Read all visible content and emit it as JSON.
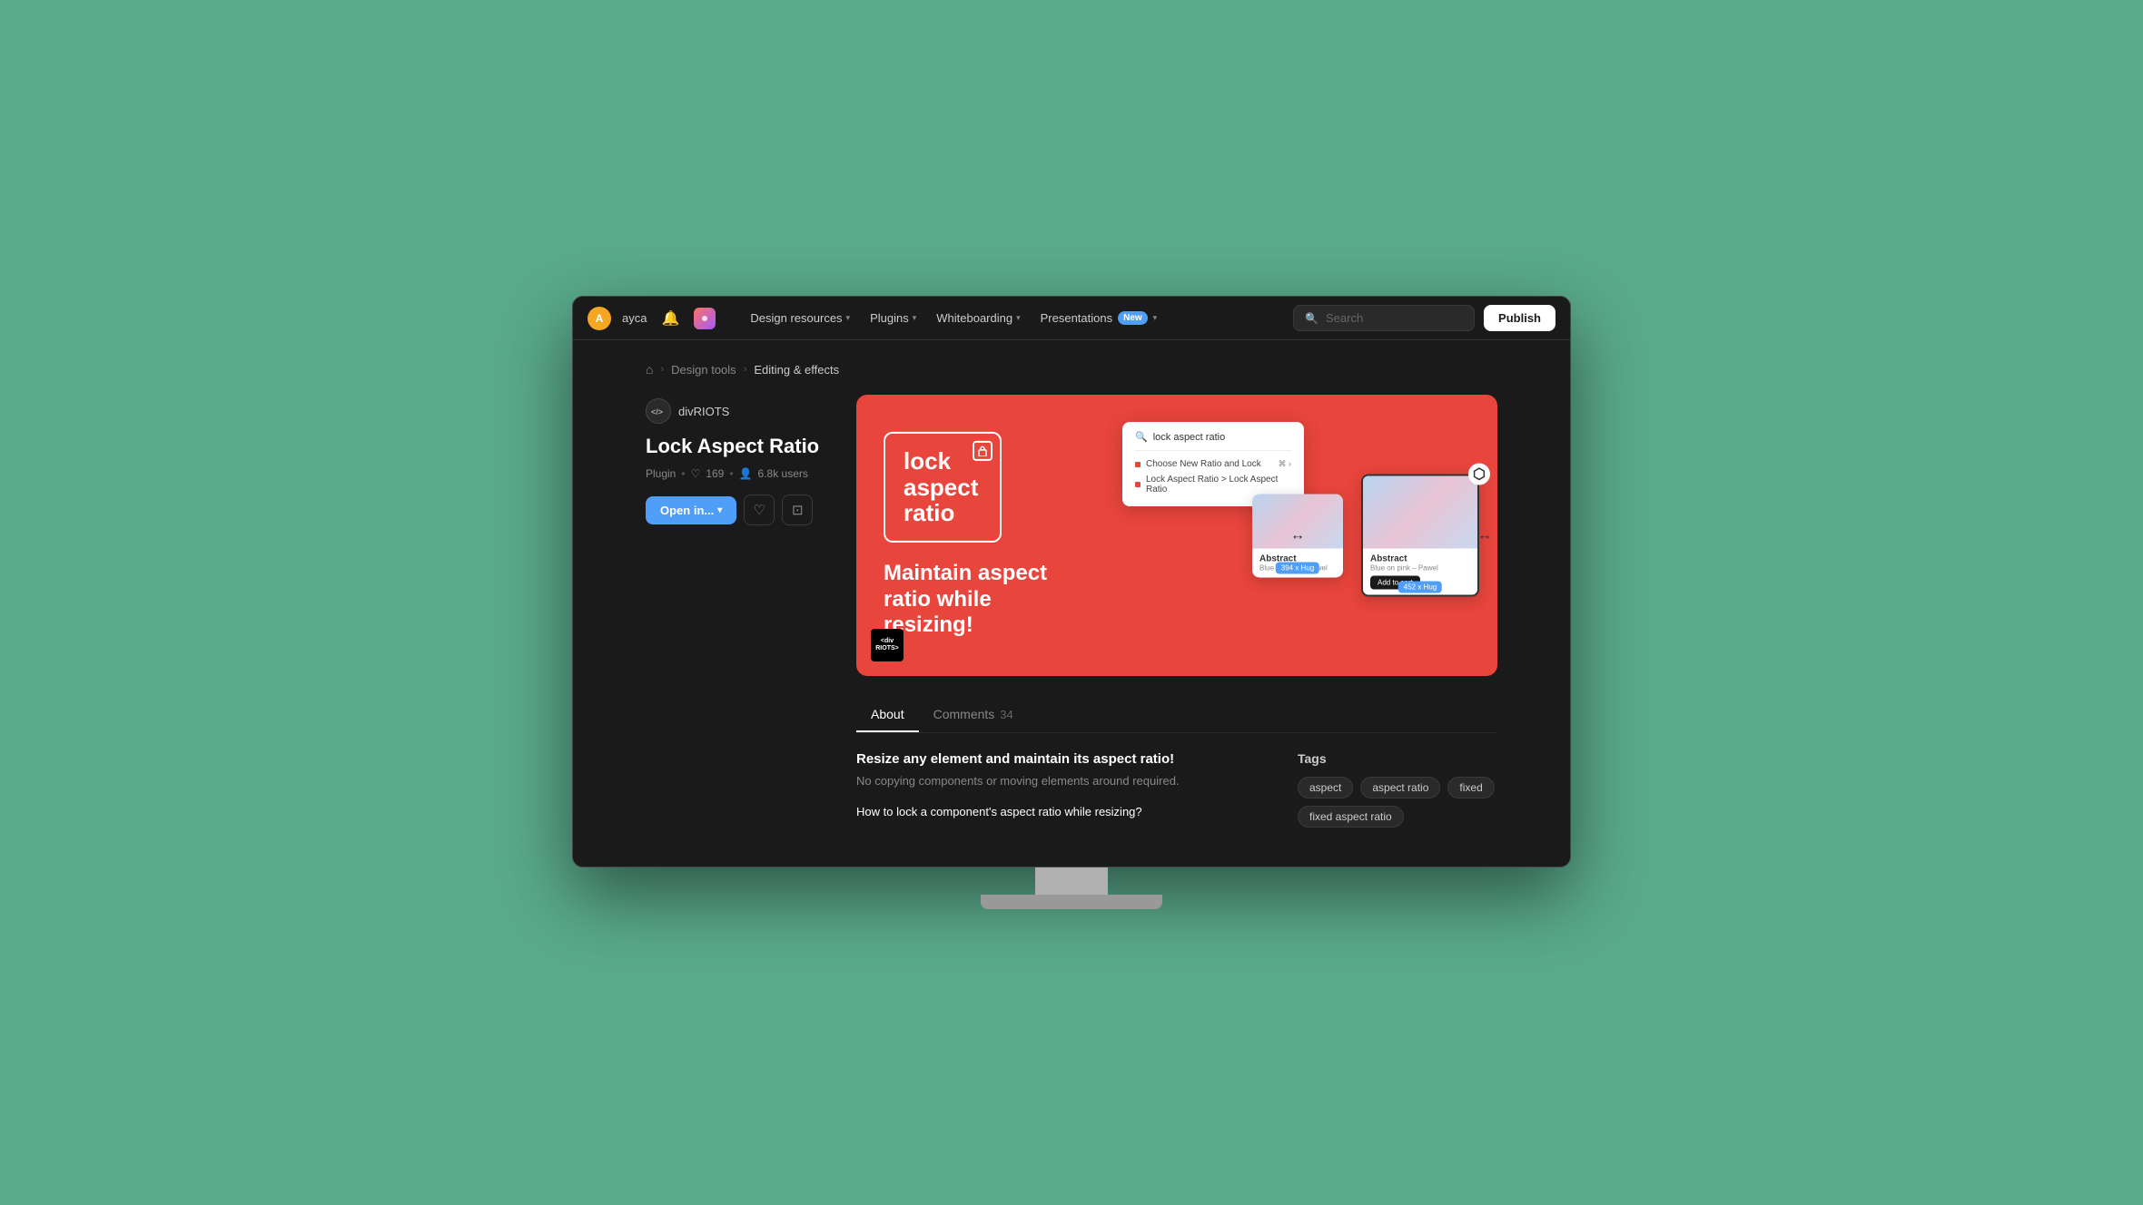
{
  "navbar": {
    "user": "ayca",
    "nav_items": [
      {
        "label": "Design resources",
        "has_dropdown": true
      },
      {
        "label": "Plugins",
        "has_dropdown": true
      },
      {
        "label": "Whiteboarding",
        "has_dropdown": true
      },
      {
        "label": "Presentations",
        "has_dropdown": true,
        "badge": "New"
      }
    ],
    "search_placeholder": "Search",
    "publish_label": "Publish"
  },
  "breadcrumb": {
    "home_icon": "🏠",
    "items": [
      "Design tools",
      "Editing & effects"
    ]
  },
  "plugin": {
    "author": "divRIOTS",
    "title": "Lock Aspect Ratio",
    "type": "Plugin",
    "likes": "169",
    "users": "6.8k users",
    "open_btn": "Open in...",
    "hero_tagline": "Maintain aspect ratio while resizing!",
    "hero_lock_text": "lock aspect ratio",
    "hero_search_text": "lock aspect ratio",
    "hero_search_items": [
      "Choose New Ratio and Lock",
      "Lock Aspect Ratio > Lock Aspect Ratio"
    ],
    "card_small_label": "Abstract",
    "card_small_sublabel": "Blue on pink – Pawel",
    "card_large_label": "Abstract",
    "card_large_sublabel": "Blue on pink – Pawel",
    "card_large_btn": "Add to cart",
    "size_badge_small": "394 x Hug",
    "size_badge_large": "452 x Hug"
  },
  "tabs": [
    {
      "label": "About",
      "active": true
    },
    {
      "label": "Comments",
      "count": "34",
      "active": false
    }
  ],
  "about": {
    "main_title": "Resize any element and maintain its aspect ratio!",
    "main_desc": "No copying components or moving elements around required.",
    "question": "How to lock a component's aspect ratio while resizing?"
  },
  "tags": {
    "title": "Tags",
    "items": [
      "aspect",
      "aspect ratio",
      "fixed",
      "fixed aspect ratio"
    ]
  }
}
